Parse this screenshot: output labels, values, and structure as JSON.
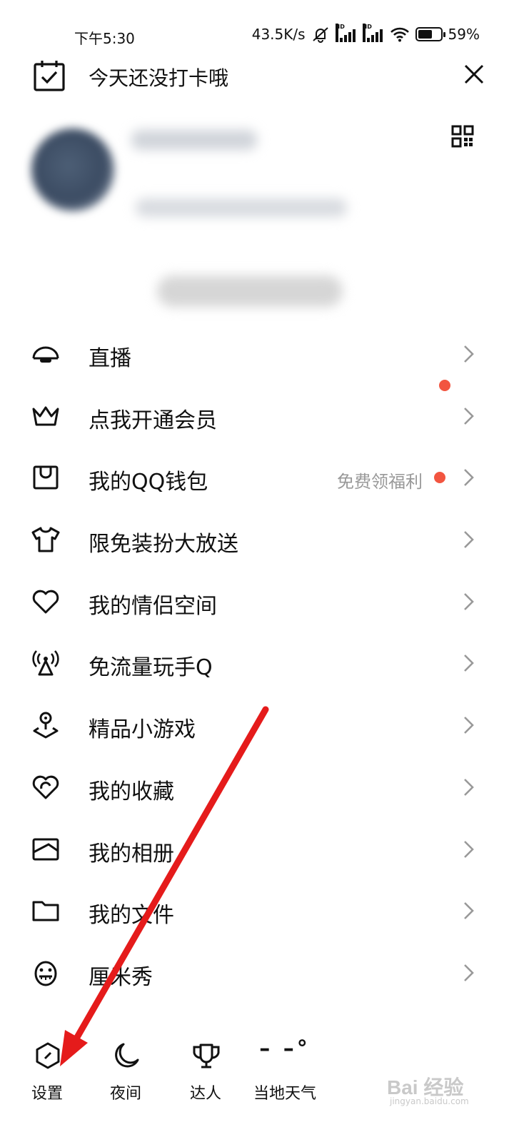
{
  "status_bar": {
    "time": "下午5:30",
    "speed": "43.5K/s",
    "battery_percent": "59%",
    "battery_level": 0.59,
    "icons": [
      "mute-bell-icon",
      "hd-signal-icon",
      "hd-signal-icon",
      "wifi-icon",
      "battery-icon"
    ]
  },
  "header": {
    "checkin_text": "今天还没打卡哦",
    "checkin_icon": "calendar-check-icon",
    "close_icon": "close-icon"
  },
  "profile": {
    "qr_icon": "qr-code-icon"
  },
  "menu": {
    "items": [
      {
        "label": "直播",
        "icon": "live-icon",
        "extra": "",
        "dot": false
      },
      {
        "label": "点我开通会员",
        "icon": "crown-icon",
        "extra": "",
        "dot": true
      },
      {
        "label": "我的QQ钱包",
        "icon": "wallet-icon",
        "extra": "免费领福利",
        "dot": true
      },
      {
        "label": "限免装扮大放送",
        "icon": "tshirt-icon",
        "extra": "",
        "dot": false
      },
      {
        "label": "我的情侣空间",
        "icon": "heart-icon",
        "extra": "",
        "dot": false
      },
      {
        "label": "免流量玩手Q",
        "icon": "signal-tower-icon",
        "extra": "",
        "dot": false
      },
      {
        "label": "精品小游戏",
        "icon": "joystick-icon",
        "extra": "",
        "dot": false
      },
      {
        "label": "我的收藏",
        "icon": "favorite-icon",
        "extra": "",
        "dot": false
      },
      {
        "label": "我的相册",
        "icon": "album-icon",
        "extra": "",
        "dot": false
      },
      {
        "label": "我的文件",
        "icon": "folder-icon",
        "extra": "",
        "dot": false
      },
      {
        "label": "厘米秀",
        "icon": "avatar-face-icon",
        "extra": "",
        "dot": false
      }
    ]
  },
  "bottom_bar": {
    "settings": {
      "label": "设置",
      "icon": "settings-hexagon-icon"
    },
    "night": {
      "label": "夜间",
      "icon": "moon-icon"
    },
    "expert": {
      "label": "达人",
      "icon": "trophy-icon"
    },
    "weather": {
      "label": "当地天气",
      "value": "– –°"
    }
  },
  "colors": {
    "accent_dot": "#f25540",
    "annotation_arrow": "#e51b1b",
    "muted_text": "#999999"
  },
  "watermark": {
    "text": "Bai 经验",
    "sub": "jingyan.baidu.com"
  }
}
